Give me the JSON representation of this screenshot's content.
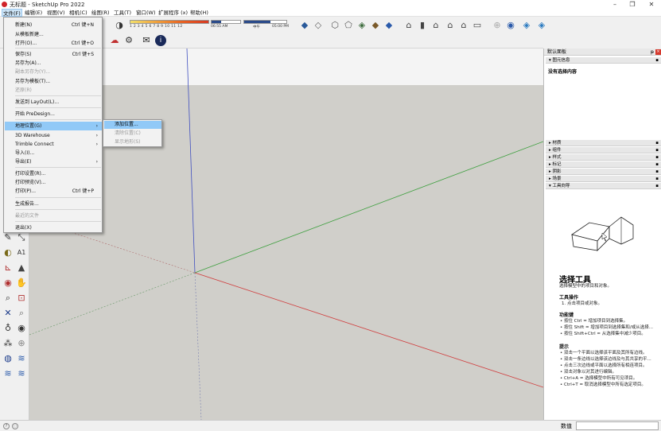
{
  "window": {
    "title": "无标题 - SketchUp Pro 2022",
    "controls": [
      "–",
      "❐",
      "✕"
    ]
  },
  "menubar": [
    "文件(F)",
    "编辑(E)",
    "视图(V)",
    "相机(C)",
    "绘图(R)",
    "工具(T)",
    "窗口(W)",
    "扩展程序 (x)",
    "帮助(H)"
  ],
  "toolbar": {
    "hour_ticks": "1  2  3  4  5  6  7  8  9  10  11  12",
    "time_start": "06:55 AM",
    "time_noon": "中午",
    "time_end": "05:00 PM"
  },
  "file_menu": {
    "items": [
      {
        "label": "新建(N)",
        "shortcut": "Ctrl 键+N"
      },
      {
        "label": "从模板新建...",
        "shortcut": ""
      },
      {
        "label": "打开(O)...",
        "shortcut": "Ctrl 键+O"
      },
      {
        "label": "保存(S)",
        "shortcut": "Ctrl 键+S"
      },
      {
        "label": "另存为(A)...",
        "shortcut": ""
      },
      {
        "label": "副本另存为(Y)...",
        "shortcut": "",
        "disabled": true
      },
      {
        "label": "另存为模板(T)...",
        "shortcut": ""
      },
      {
        "label": "还原(R)",
        "shortcut": "",
        "disabled": true
      },
      {
        "label": "发送到 LayOut(L)...",
        "shortcut": ""
      },
      {
        "label": "开始 PreDesign...",
        "shortcut": ""
      },
      {
        "label": "地理位置(G)",
        "shortcut": "",
        "submenu": true
      },
      {
        "label": "3D Warehouse",
        "shortcut": "",
        "submenu": true
      },
      {
        "label": "Trimble Connect",
        "shortcut": "",
        "submenu": true
      },
      {
        "label": "导入(I)...",
        "shortcut": ""
      },
      {
        "label": "导出(E)",
        "shortcut": "",
        "submenu": true
      },
      {
        "label": "打印设置(R)...",
        "shortcut": ""
      },
      {
        "label": "打印预览(V)...",
        "shortcut": ""
      },
      {
        "label": "打印(P)...",
        "shortcut": "Ctrl 键+P"
      },
      {
        "label": "生成报告...",
        "shortcut": ""
      },
      {
        "label": "最近的文件",
        "shortcut": "",
        "disabled": true
      },
      {
        "label": "退出(X)",
        "shortcut": ""
      }
    ]
  },
  "geo_submenu": {
    "items": [
      {
        "label": "添加位置...",
        "disabled": false
      },
      {
        "label": "清除位置(C)",
        "disabled": true
      },
      {
        "label": "显示地形(S)",
        "disabled": true
      }
    ]
  },
  "tray": {
    "title": "默认面板",
    "entity_info_header": "图元信息",
    "entity_info_text": "没有选择内容",
    "panels": [
      "材质",
      "组件",
      "样式",
      "标记",
      "阴影",
      "场景",
      "工具向导"
    ],
    "instructor": {
      "title": "选择工具",
      "subtitle": "选择模型中的项目和对象。",
      "ops_title": "工具操作",
      "ops": [
        "1. 点击项目或对象。"
      ],
      "keys_title": "功能键",
      "keys": [
        "• 按住 Ctrl = 增加项目到选择集。",
        "• 按住 Shift = 增加项目到选择集和/或从选择...",
        "• 按住 Shift+Ctrl = 从选择集中减少项目。"
      ],
      "tips_title": "提示",
      "tips": [
        "• 双击一个平面以选择该平面及其所有边线。",
        "• 双击一条边线以选择该边线及与其共享的平...",
        "• 点击三次边线或平面以选择所有相连项目。",
        "• 双击对象以对其进行编辑。",
        "• Ctrl+A = 选择模型中所有可见项目。",
        "• Ctrl+T = 取消选择模型中所有选定项目。"
      ]
    }
  },
  "statusbar": {
    "value_label": "数值",
    "value": ""
  },
  "colors": {
    "axis_red": "#d04040",
    "axis_green": "#3fa040",
    "axis_blue": "#4050c0",
    "menu_highlight": "#91c9f7"
  }
}
